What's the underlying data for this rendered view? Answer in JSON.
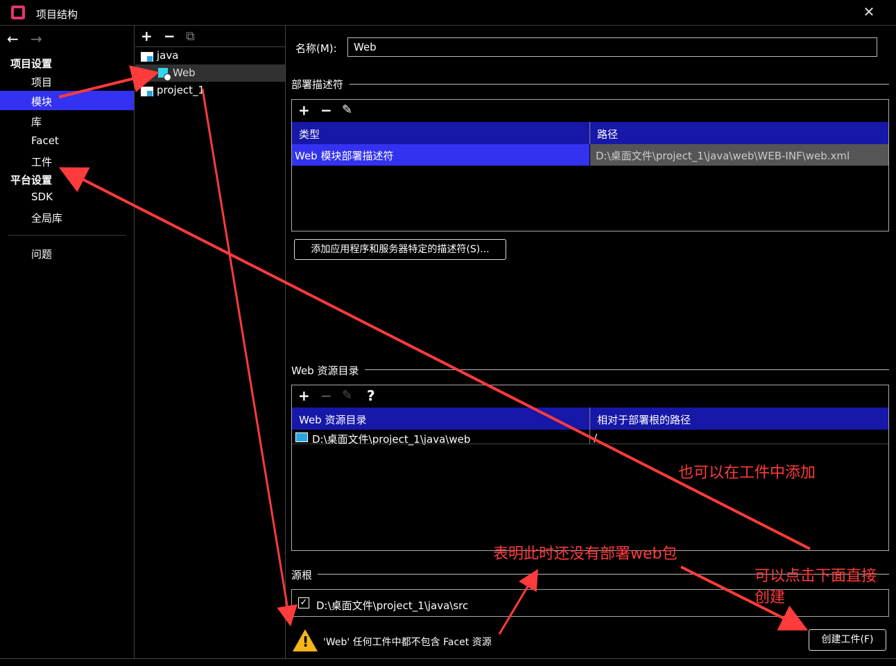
{
  "window": {
    "title": "项目结构"
  },
  "nav": {
    "back": "←",
    "forward": "→",
    "project_settings": "项目设置",
    "items_project": [
      "项目",
      "模块",
      "库",
      "Facet",
      "工件"
    ],
    "platform_settings": "平台设置",
    "items_platform": [
      "SDK",
      "全局库"
    ],
    "problems": "问题"
  },
  "modules": {
    "add": "+",
    "remove": "−",
    "copy": "⧉",
    "tree": [
      {
        "label": "java"
      },
      {
        "label": "Web"
      },
      {
        "label": "project_1"
      }
    ]
  },
  "detail": {
    "name_label": "名称(M):",
    "name_value": "Web",
    "descriptors_label": "部署描述符",
    "descriptors_columns": [
      "类型",
      "路径"
    ],
    "descriptors_rows": [
      {
        "type": "Web 模块部署描述符",
        "path": "D:\\桌面文件\\project_1\\java\\web\\WEB-INF\\web.xml"
      }
    ],
    "add_descriptor_button": "添加应用程序和服务器特定的描述符(S)...",
    "web_resource_label": "Web 资源目录",
    "web_resource_columns": [
      "Web 资源目录",
      "相对于部署根的路径"
    ],
    "web_resource_rows": [
      {
        "dir": "D:\\桌面文件\\project_1\\java\\web",
        "rel": "/"
      }
    ],
    "source_roots_label": "源根",
    "source_root": "D:\\桌面文件\\project_1\\java\\src",
    "warning": "'Web' 任何工件中都不包含 Facet 资源",
    "create_artifact_button": "创建工件(F)"
  },
  "annotations": {
    "note1": "也可以在工件中添加",
    "note2": "表明此时还没有部署web包",
    "note3": "可以点击下面直接",
    "note4": "创建"
  },
  "colors": {
    "selection": "#3332f0",
    "header": "#1717a8",
    "annotation": "#ff3b3b",
    "warning": "#f5b51b"
  }
}
